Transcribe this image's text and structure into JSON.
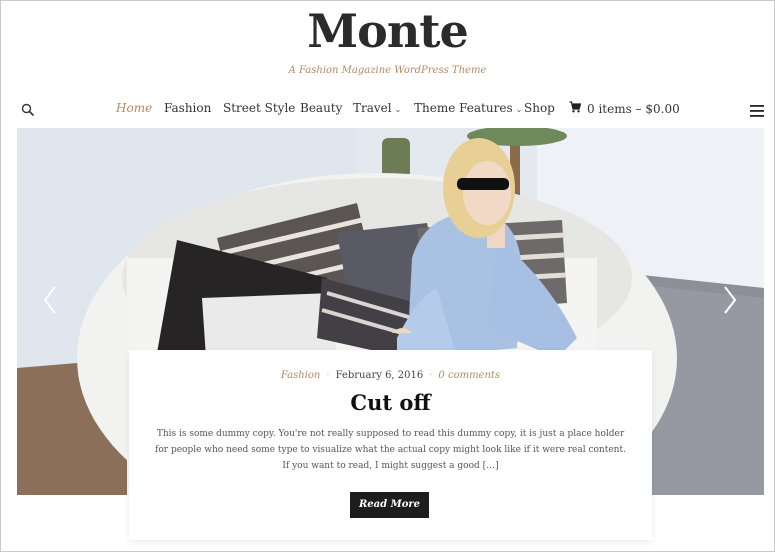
{
  "site": {
    "title": "Monte",
    "tagline": "A Fashion Magazine WordPress Theme"
  },
  "nav": {
    "items": [
      {
        "label": "Home",
        "active": true,
        "dropdown": false
      },
      {
        "label": "Fashion",
        "active": false,
        "dropdown": false
      },
      {
        "label": "Street Style",
        "active": false,
        "dropdown": false
      },
      {
        "label": "Beauty",
        "active": false,
        "dropdown": false
      },
      {
        "label": "Travel",
        "active": false,
        "dropdown": true
      },
      {
        "label": "Theme Features",
        "active": false,
        "dropdown": true
      },
      {
        "label": "Shop",
        "active": false,
        "dropdown": false
      }
    ],
    "cart_label": "0 items – $0.00",
    "dropdown_caret": "⌄"
  },
  "icons": {
    "search": "search-icon",
    "menu": "hamburger-menu-icon",
    "cart": "shopping-cart-icon",
    "prev": "chevron-left-icon",
    "next": "chevron-right-icon"
  },
  "post": {
    "category": "Fashion",
    "date": "February 6, 2016",
    "comments": "0 comments",
    "title": "Cut off",
    "excerpt": "This is some dummy copy. You're not really supposed to read this dummy copy, it is just a place holder for people who need some type to visualize what the actual copy might look like if it were real content. If you want to read, I might suggest a good […]",
    "read_more": "Read More"
  },
  "colors": {
    "accent": "#b48a62",
    "button_bg": "#1d1d1d",
    "text": "#333333"
  }
}
